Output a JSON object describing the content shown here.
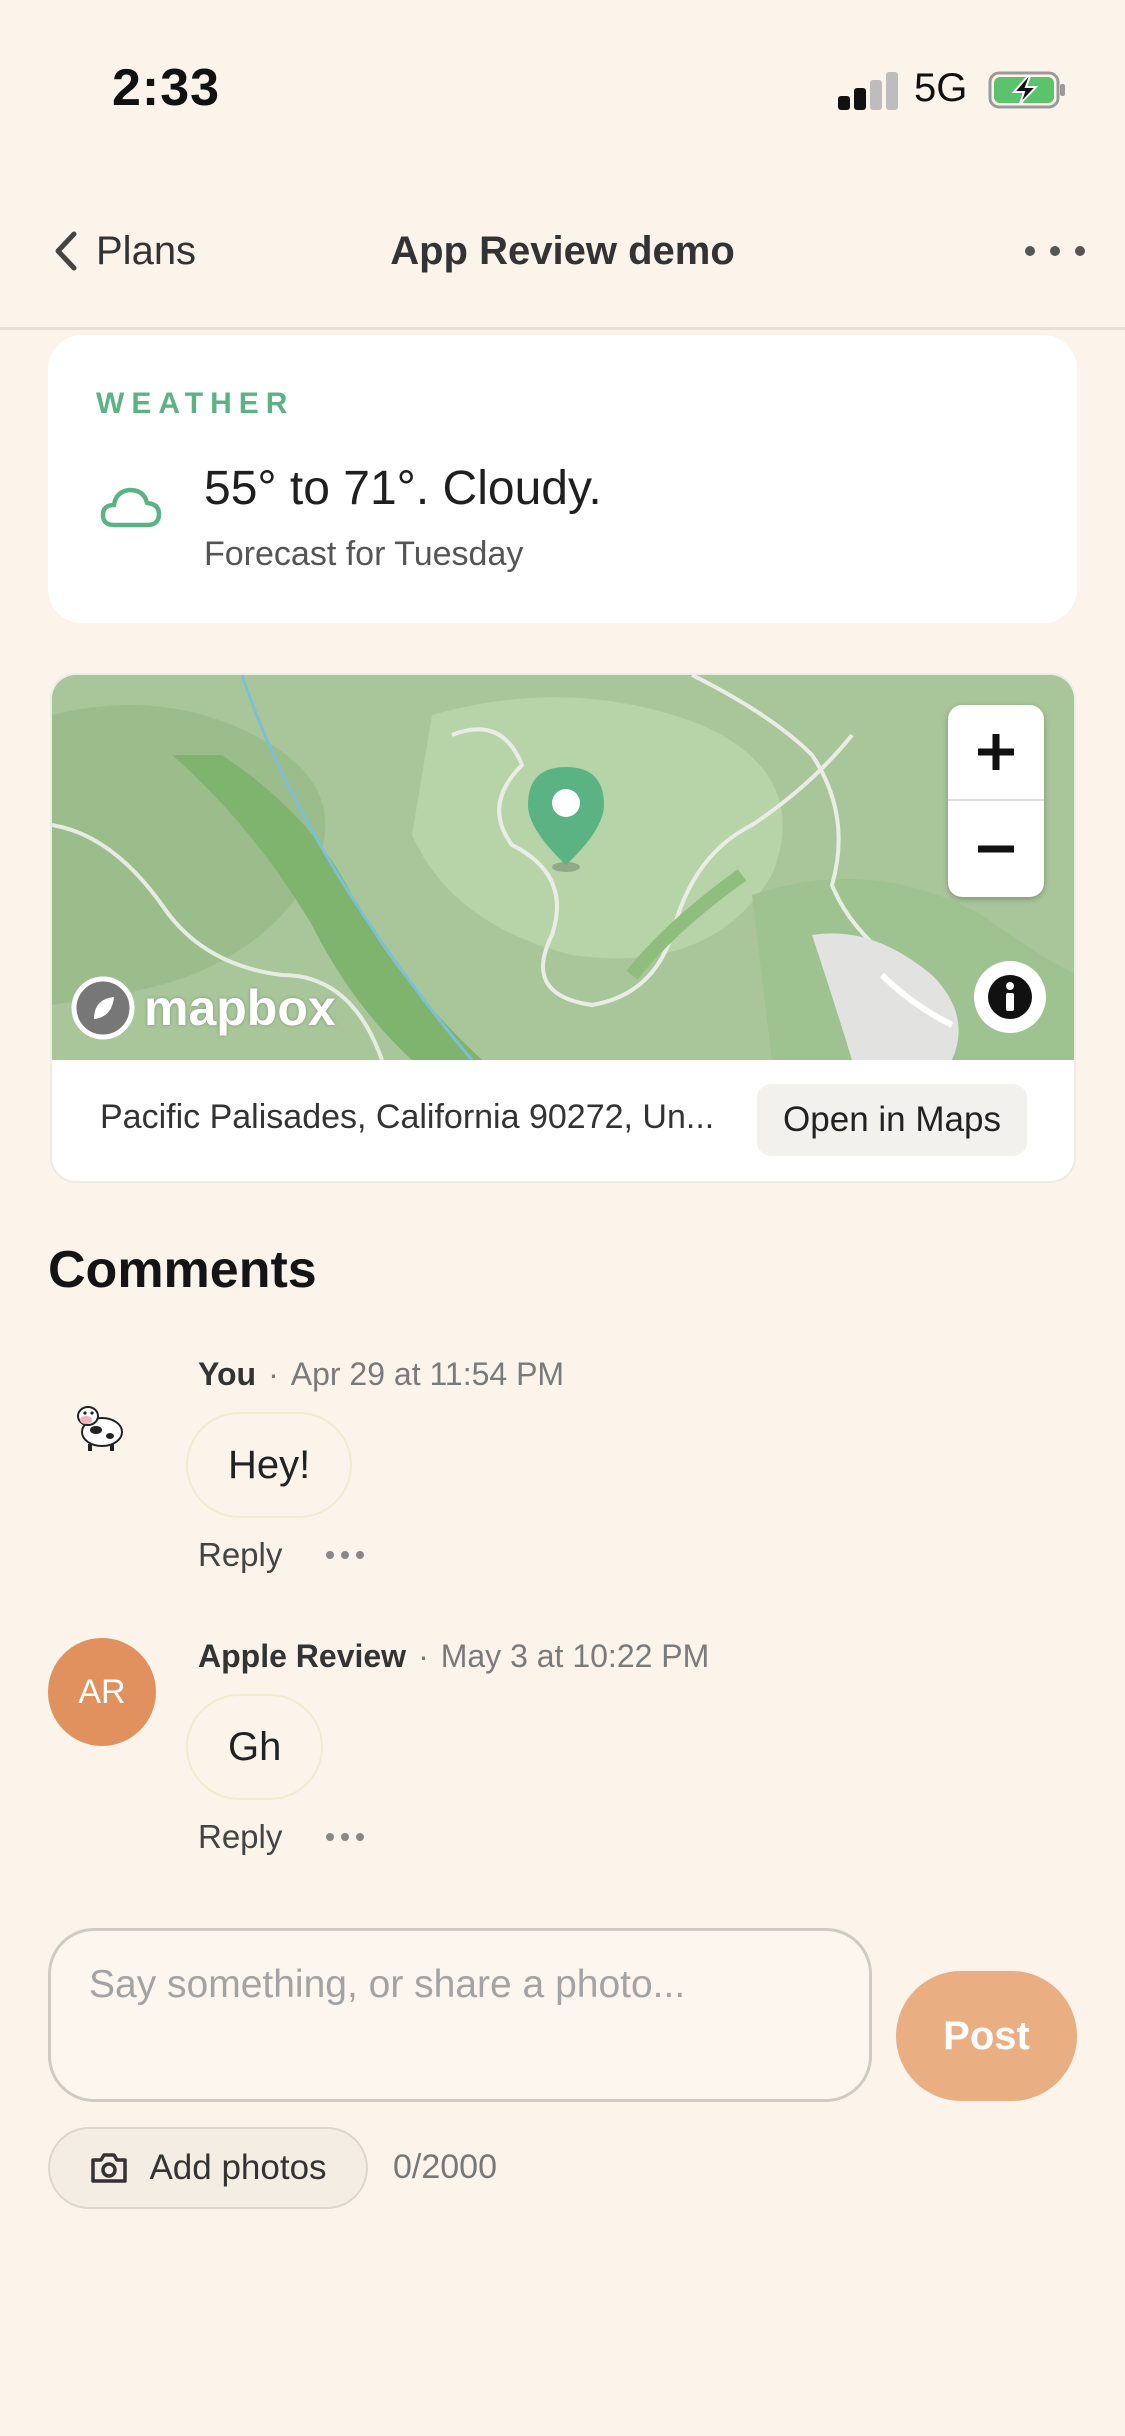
{
  "status_bar": {
    "time": "2:33",
    "network": "5G"
  },
  "nav": {
    "back_label": "Plans",
    "title": "App Review demo"
  },
  "weather": {
    "label": "WEATHER",
    "summary": "55° to 71°. Cloudy.",
    "forecast": "Forecast for Tuesday",
    "icon": "cloud-icon"
  },
  "map": {
    "attribution": "mapbox",
    "address": "Pacific Palisades, California 90272, Un...",
    "open_maps_label": "Open in Maps"
  },
  "comments": {
    "title": "Comments",
    "items": [
      {
        "author": "You",
        "timestamp": "Apr 29 at 11:54 PM",
        "text": "Hey!",
        "reply_label": "Reply",
        "avatar": "cow-icon"
      },
      {
        "author": "Apple Review",
        "initials": "AR",
        "timestamp": "May 3 at 10:22 PM",
        "text": "Gh",
        "reply_label": "Reply"
      }
    ]
  },
  "composer": {
    "placeholder": "Say something, or share a photo...",
    "post_label": "Post",
    "add_photos_label": "Add photos",
    "char_count": "0/2000"
  },
  "colors": {
    "background": "#fcf4ea",
    "accent_green": "#5bb384",
    "accent_orange": "#e0915d",
    "post_button": "#e9ae82"
  }
}
